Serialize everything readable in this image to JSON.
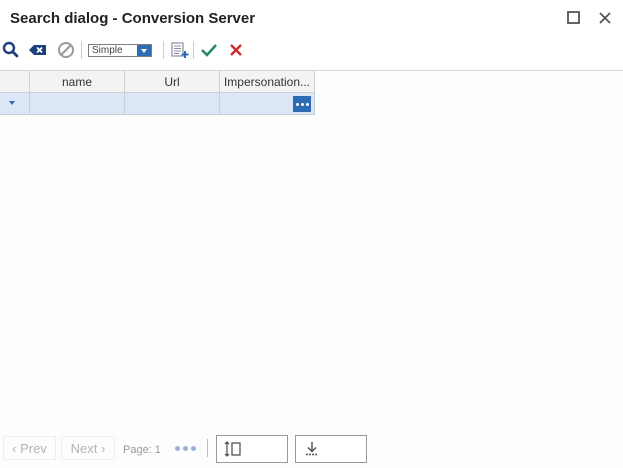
{
  "window": {
    "title": "Search dialog - Conversion Server",
    "maximize_icon": "maximize-icon",
    "close_icon": "close-icon"
  },
  "toolbar": {
    "search_icon": "search-icon",
    "clear_icon": "backspace-clear-icon",
    "cancel_icon": "disabled-circle-icon",
    "mode_select": {
      "value": "Simple"
    },
    "add_list_icon": "list-add-icon",
    "ok_icon": "checkmark-icon",
    "close_icon": "cross-icon"
  },
  "grid": {
    "columns": [
      "name",
      "Url",
      "Impersonation..."
    ],
    "rows": [
      {
        "name": "",
        "Url": "",
        "Impersonation": ""
      }
    ]
  },
  "pager": {
    "prev_label": "Prev",
    "next_label": "Next",
    "page_label": "Page: 1"
  },
  "colors": {
    "accent": "#2d6bb5",
    "ok": "#2a8a6a",
    "close": "#cc2b2b",
    "selected_row": "#dce6f5"
  }
}
